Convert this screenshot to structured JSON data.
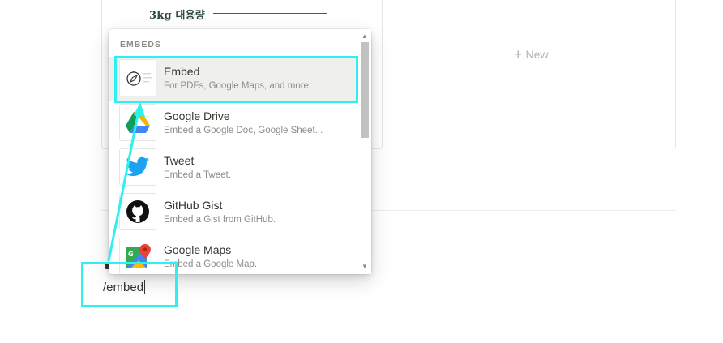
{
  "gallery": {
    "card_caption": "3kg 대용량",
    "new_label": "New"
  },
  "menu": {
    "section_label": "EMBEDS",
    "items": [
      {
        "title": "Embed",
        "description": "For PDFs, Google Maps, and more.",
        "icon": "compass-icon",
        "selected": true
      },
      {
        "title": "Google Drive",
        "description": "Embed a Google Doc, Google Sheet...",
        "icon": "google-drive-icon"
      },
      {
        "title": "Tweet",
        "description": "Embed a Tweet.",
        "icon": "twitter-bird-icon"
      },
      {
        "title": "GitHub Gist",
        "description": "Embed a Gist from GitHub.",
        "icon": "github-icon"
      },
      {
        "title": "Google Maps",
        "description": "Embed a Google Map.",
        "icon": "google-maps-icon"
      }
    ]
  },
  "command_input": {
    "value": "/embed"
  },
  "colors": {
    "highlight": "#2ef0f0",
    "selected_bg": "#efefee",
    "text": "#37352f",
    "muted": "#8e8c87"
  }
}
